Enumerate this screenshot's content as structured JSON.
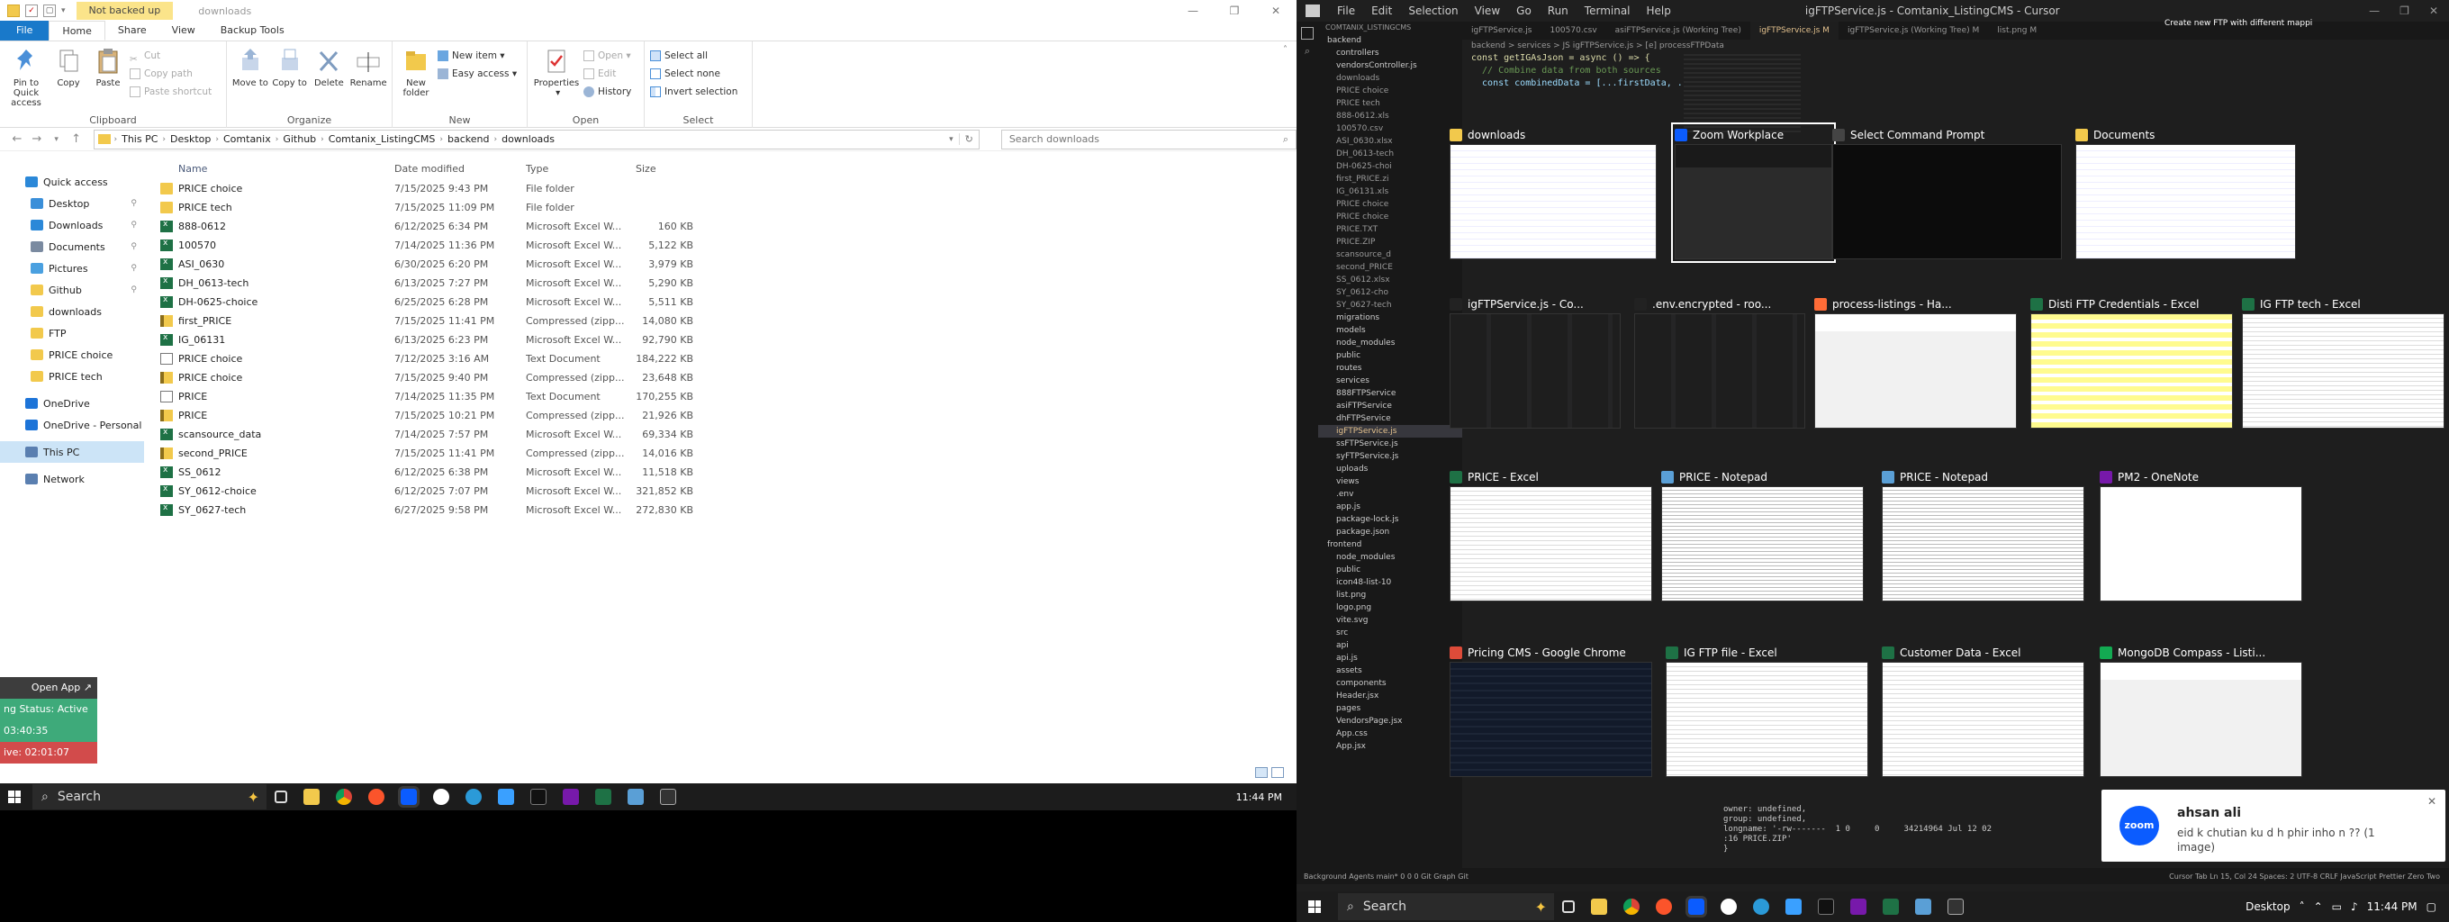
{
  "explorer": {
    "title_badge": "Not backed up",
    "title": "downloads",
    "tabs": [
      "File",
      "Home",
      "Share",
      "View",
      "Backup Tools"
    ],
    "ribbon": {
      "clipboard": {
        "label": "Clipboard",
        "pin": "Pin to Quick access",
        "copy": "Copy",
        "paste": "Paste",
        "cut": "Cut",
        "copy_path": "Copy path",
        "paste_shortcut": "Paste shortcut"
      },
      "organize": {
        "label": "Organize",
        "move_to": "Move to",
        "copy_to": "Copy to",
        "delete": "Delete",
        "rename": "Rename"
      },
      "new": {
        "label": "New",
        "new_folder": "New folder",
        "new_item": "New item",
        "easy_access": "Easy access"
      },
      "open": {
        "label": "Open",
        "properties": "Properties",
        "open": "Open",
        "edit": "Edit",
        "history": "History"
      },
      "select": {
        "label": "Select",
        "select_all": "Select all",
        "select_none": "Select none",
        "invert": "Invert selection"
      }
    },
    "breadcrumb": [
      "This PC",
      "Desktop",
      "Comtanix",
      "Github",
      "Comtanix_ListingCMS",
      "backend",
      "downloads"
    ],
    "search_placeholder": "Search downloads",
    "nav": [
      {
        "label": "Quick access",
        "color": "#2b88d8",
        "sub": false,
        "pinned": false
      },
      {
        "label": "Desktop",
        "color": "#3a8fd9",
        "sub": true,
        "pinned": true
      },
      {
        "label": "Downloads",
        "color": "#2b88d8",
        "sub": true,
        "pinned": true
      },
      {
        "label": "Documents",
        "color": "#7a8aa0",
        "sub": true,
        "pinned": true
      },
      {
        "label": "Pictures",
        "color": "#4aa0e0",
        "sub": true,
        "pinned": true
      },
      {
        "label": "Github",
        "color": "#f2c94c",
        "sub": true,
        "pinned": true
      },
      {
        "label": "downloads",
        "color": "#f2c94c",
        "sub": true,
        "pinned": false
      },
      {
        "label": "FTP",
        "color": "#f2c94c",
        "sub": true,
        "pinned": false
      },
      {
        "label": "PRICE choice",
        "color": "#f2c94c",
        "sub": true,
        "pinned": false
      },
      {
        "label": "PRICE tech",
        "color": "#f2c94c",
        "sub": true,
        "pinned": false
      },
      {
        "label": "OneDrive",
        "color": "#1d74d8",
        "sub": false,
        "pinned": false
      },
      {
        "label": "OneDrive - Personal",
        "color": "#1d74d8",
        "sub": false,
        "pinned": false
      },
      {
        "label": "This PC",
        "color": "#5a7fb0",
        "sub": false,
        "pinned": false,
        "selected": true
      },
      {
        "label": "Network",
        "color": "#5a7fb0",
        "sub": false,
        "pinned": false
      }
    ],
    "columns": {
      "name": "Name",
      "date": "Date modified",
      "type": "Type",
      "size": "Size"
    },
    "files": [
      {
        "name": "PRICE choice",
        "date": "7/15/2025 9:43 PM",
        "type": "File folder",
        "size": "",
        "kind": "folder"
      },
      {
        "name": "PRICE tech",
        "date": "7/15/2025 11:09 PM",
        "type": "File folder",
        "size": "",
        "kind": "folder"
      },
      {
        "name": "888-0612",
        "date": "6/12/2025 6:34 PM",
        "type": "Microsoft Excel W...",
        "size": "160 KB",
        "kind": "excel"
      },
      {
        "name": "100570",
        "date": "7/14/2025 11:36 PM",
        "type": "Microsoft Excel W...",
        "size": "5,122 KB",
        "kind": "excel"
      },
      {
        "name": "ASI_0630",
        "date": "6/30/2025 6:20 PM",
        "type": "Microsoft Excel W...",
        "size": "3,979 KB",
        "kind": "excel"
      },
      {
        "name": "DH_0613-tech",
        "date": "6/13/2025 7:27 PM",
        "type": "Microsoft Excel W...",
        "size": "5,290 KB",
        "kind": "excel"
      },
      {
        "name": "DH-0625-choice",
        "date": "6/25/2025 6:28 PM",
        "type": "Microsoft Excel W...",
        "size": "5,511 KB",
        "kind": "excel"
      },
      {
        "name": "first_PRICE",
        "date": "7/15/2025 11:41 PM",
        "type": "Compressed (zipp...",
        "size": "14,080 KB",
        "kind": "zip"
      },
      {
        "name": "IG_06131",
        "date": "6/13/2025 6:23 PM",
        "type": "Microsoft Excel W...",
        "size": "92,790 KB",
        "kind": "excel"
      },
      {
        "name": "PRICE choice",
        "date": "7/12/2025 3:16 AM",
        "type": "Text Document",
        "size": "184,222 KB",
        "kind": "text"
      },
      {
        "name": "PRICE choice",
        "date": "7/15/2025 9:40 PM",
        "type": "Compressed (zipp...",
        "size": "23,648 KB",
        "kind": "zip"
      },
      {
        "name": "PRICE",
        "date": "7/14/2025 11:35 PM",
        "type": "Text Document",
        "size": "170,255 KB",
        "kind": "text"
      },
      {
        "name": "PRICE",
        "date": "7/15/2025 10:21 PM",
        "type": "Compressed (zipp...",
        "size": "21,926 KB",
        "kind": "zip"
      },
      {
        "name": "scansource_data",
        "date": "7/14/2025 7:57 PM",
        "type": "Microsoft Excel W...",
        "size": "69,334 KB",
        "kind": "excel"
      },
      {
        "name": "second_PRICE",
        "date": "7/15/2025 11:41 PM",
        "type": "Compressed (zipp...",
        "size": "14,016 KB",
        "kind": "zip"
      },
      {
        "name": "SS_0612",
        "date": "6/12/2025 6:38 PM",
        "type": "Microsoft Excel W...",
        "size": "11,518 KB",
        "kind": "excel"
      },
      {
        "name": "SY_0612-choice",
        "date": "6/12/2025 7:07 PM",
        "type": "Microsoft Excel W...",
        "size": "321,852 KB",
        "kind": "excel"
      },
      {
        "name": "SY_0627-tech",
        "date": "6/27/2025 9:58 PM",
        "type": "Microsoft Excel W...",
        "size": "272,830 KB",
        "kind": "excel"
      }
    ]
  },
  "status_widget": {
    "open_app": "Open App",
    "status": "ng Status: Active",
    "time1": "03:40:35",
    "time2": "ive: 02:01:07"
  },
  "taskbar_left": {
    "search": "Search",
    "clock": "11:44 PM"
  },
  "ide": {
    "menu": [
      "File",
      "Edit",
      "Selection",
      "View",
      "Go",
      "Run",
      "Terminal",
      "Help"
    ],
    "title": "igFTPService.js - Comtanix_ListingCMS - Cursor",
    "tabs": [
      "igFTPService.js",
      "100570.csv",
      "asiFTPService.js (Working Tree)",
      "igFTPService.js M",
      "igFTPService.js (Working Tree) M",
      "list.png M"
    ],
    "breadcrumb": "backend > services > JS igFTPService.js > [e] processFTPData",
    "code": [
      {
        "t": "const getIGAsJson = async () => {",
        "c": "fn"
      },
      {
        "t": "  // Combine data from both sources",
        "c": "cm"
      },
      {
        "t": "  const combinedData = [...firstData, ...secondData];",
        "c": "pr"
      }
    ],
    "terminal": [
      "owner: undefined,",
      "group: undefined,",
      "longname: '-rw-------  1 0     0     34214964 Jul 12 02",
      ":16 PRICE.ZIP'",
      "}"
    ],
    "chat_header": "Create new FTP with different mappi",
    "sidebar_title": "COMTANIX_LISTINGCMS",
    "tree": [
      "backend",
      "controllers",
      "vendorsController.js",
      "downloads",
      "PRICE choice",
      "PRICE tech",
      "888-0612.xls",
      "100570.csv",
      "ASI_0630.xlsx",
      "DH_0613-tech",
      "DH-0625-choi",
      "first_PRICE.zi",
      "IG_06131.xls",
      "PRICE choice",
      "PRICE choice",
      "PRICE.TXT",
      "PRICE.ZIP",
      "scansource_d",
      "second_PRICE",
      "SS_0612.xlsx",
      "SY_0612-cho",
      "SY_0627-tech",
      "migrations",
      "models",
      "node_modules",
      "public",
      "routes",
      "services",
      "888FTPService",
      "asiFTPService",
      "dhFTPService",
      "igFTPService.js",
      "ssFTPService.js",
      "syFTPService.js",
      "uploads",
      "views",
      ".env",
      "app.js",
      "package-lock.js",
      "package.json",
      "frontend",
      "node_modules",
      "public",
      "icon48-list-10",
      "list.png",
      "logo.png",
      "vite.svg",
      "src",
      "api",
      "api.js",
      "assets",
      "components",
      "Header.jsx",
      "pages",
      "VendorsPage.jsx",
      "App.css",
      "App.jsx"
    ],
    "statusbar": "Background Agents   main*   0 0 0   Git Graph   Git",
    "statusbar_right": "Cursor Tab   Ln 15, Col 24   Spaces: 2   UTF-8   CRLF   JavaScript   Prettier   Zero Two"
  },
  "alt_tab": [
    {
      "title": "downloads",
      "icon_color": "#f2c94c",
      "kind": "explorer",
      "selected": false
    },
    {
      "title": "Zoom Workplace",
      "icon_color": "#0b5cff",
      "kind": "zoom",
      "selected": true
    },
    {
      "title": "Select Command Prompt",
      "icon_color": "#444",
      "kind": "cmd",
      "selected": false
    },
    {
      "title": "Documents",
      "icon_color": "#f2c94c",
      "kind": "explorer",
      "selected": false
    },
    {
      "title": "igFTPService.js - Co...",
      "icon_color": "#222",
      "kind": "ide",
      "selected": false
    },
    {
      "title": ".env.encrypted - roo...",
      "icon_color": "#222",
      "kind": "ide",
      "selected": false
    },
    {
      "title": "process-listings - Ha...",
      "icon_color": "#ff6c37",
      "kind": "web",
      "selected": false
    },
    {
      "title": "Disti FTP Credentials - Excel",
      "icon_color": "#1e7145",
      "kind": "excel-yellow",
      "selected": false
    },
    {
      "title": "IG FTP tech - Excel",
      "icon_color": "#1e7145",
      "kind": "excel",
      "selected": false
    },
    {
      "title": "PRICE - Excel",
      "icon_color": "#1e7145",
      "kind": "excel",
      "selected": false
    },
    {
      "title": "PRICE - Notepad",
      "icon_color": "#5a9fd6",
      "kind": "notepad",
      "selected": false
    },
    {
      "title": "PRICE - Notepad",
      "icon_color": "#5a9fd6",
      "kind": "notepad",
      "selected": false
    },
    {
      "title": "PM2 - OneNote",
      "icon_color": "#7719aa",
      "kind": "onenote",
      "selected": false
    },
    {
      "title": "Pricing CMS - Google Chrome",
      "icon_color": "#dd4b39",
      "kind": "chrome",
      "selected": false
    },
    {
      "title": "IG FTP file - Excel",
      "icon_color": "#1e7145",
      "kind": "excel",
      "selected": false
    },
    {
      "title": "Customer Data - Excel",
      "icon_color": "#1e7145",
      "kind": "excel",
      "selected": false
    },
    {
      "title": "MongoDB Compass - Listi...",
      "icon_color": "#13aa52",
      "kind": "web",
      "selected": false
    }
  ],
  "toast": {
    "logo": "zoom",
    "sender": "ahsan ali",
    "message": "eid k chutian ku d h phir inho n ?? (1 image)"
  },
  "taskbar_right": {
    "search": "Search",
    "desktop": "Desktop",
    "clock": "11:44 PM"
  }
}
